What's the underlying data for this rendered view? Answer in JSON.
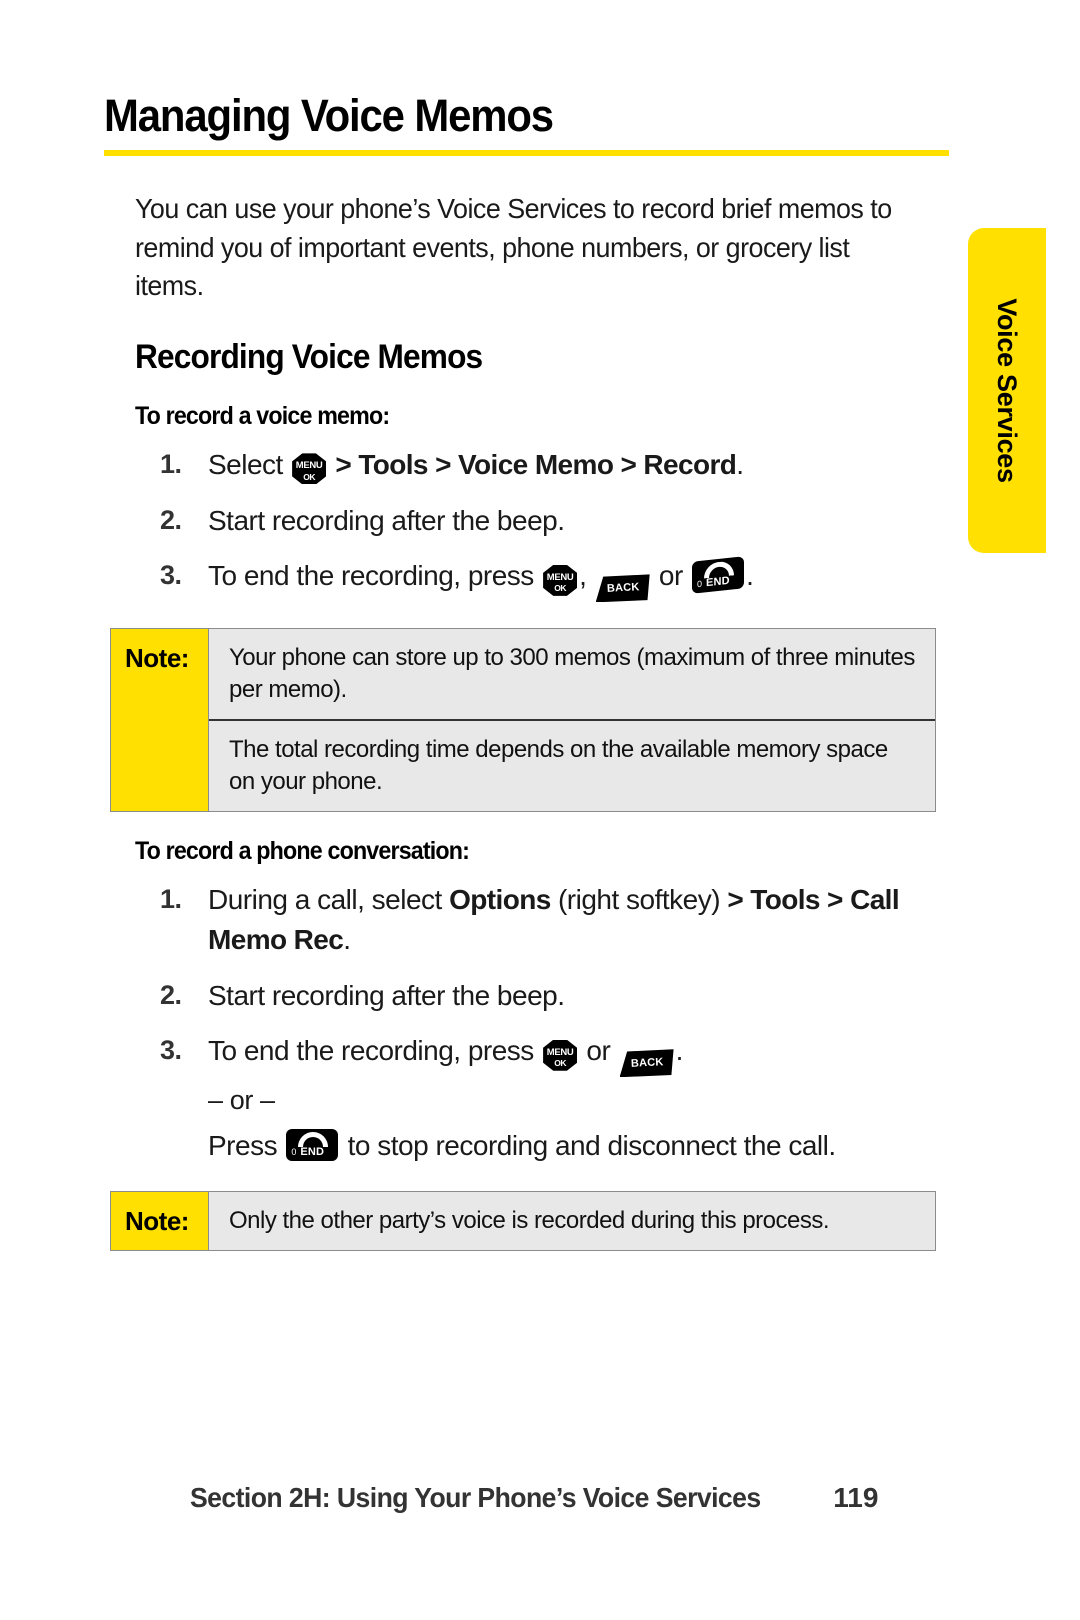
{
  "side_tab": {
    "label": "Voice Services",
    "color": "#ffe000"
  },
  "header": {
    "title": "Managing Voice Memos",
    "rule_color": "#ffe000"
  },
  "intro": "You can use your phone’s Voice Services to record brief memos to remind you of important events, phone numbers, or grocery list items.",
  "section_recording": {
    "heading": "Recording Voice Memos",
    "subheading": "To record a voice memo:",
    "steps": [
      {
        "num": "1.",
        "prefix": "Select ",
        "key1": "menu-ok",
        "bold_path": "> Tools > Voice Memo > Record",
        "suffix": "."
      },
      {
        "num": "2.",
        "text": "Start recording after the beep."
      },
      {
        "num": "3.",
        "prefix": "To end the recording, press ",
        "key1": "menu-ok",
        "mid1": ", ",
        "key2": "back",
        "mid2": " or ",
        "key3": "end",
        "suffix": "."
      }
    ],
    "note": {
      "label": "Note:",
      "paragraphs": [
        "Your phone can store up to 300 memos (maximum of three minutes per memo).",
        "The total recording time depends on the available memory space on your phone."
      ]
    }
  },
  "section_conversation": {
    "subheading": "To record a phone conversation:",
    "steps": [
      {
        "num": "1.",
        "prefix": "During a call, select ",
        "bold1": "Options",
        "mid1": " (right softkey) ",
        "bold2": "> Tools >",
        "bold3": "Call Memo Rec",
        "suffix": "."
      },
      {
        "num": "2.",
        "text": "Start recording after the beep."
      },
      {
        "num": "3.",
        "prefix": "To end the recording, press ",
        "key1": "menu-ok",
        "mid1": " or ",
        "key2": "back",
        "suffix": ".",
        "or_text": "– or –",
        "alt_prefix": "Press ",
        "alt_key": "end",
        "alt_suffix": " to stop recording and disconnect the call."
      }
    ],
    "note": {
      "label": "Note:",
      "paragraphs": [
        "Only the other party’s voice is recorded during this process."
      ]
    }
  },
  "keys": {
    "menu_ok": {
      "line1": "MENU",
      "line2": "OK"
    },
    "back": {
      "label": "BACK"
    },
    "end": {
      "label": "END",
      "prefix": "0"
    }
  },
  "footer": {
    "text": "Section 2H: Using Your Phone’s Voice Services",
    "page": "119"
  }
}
